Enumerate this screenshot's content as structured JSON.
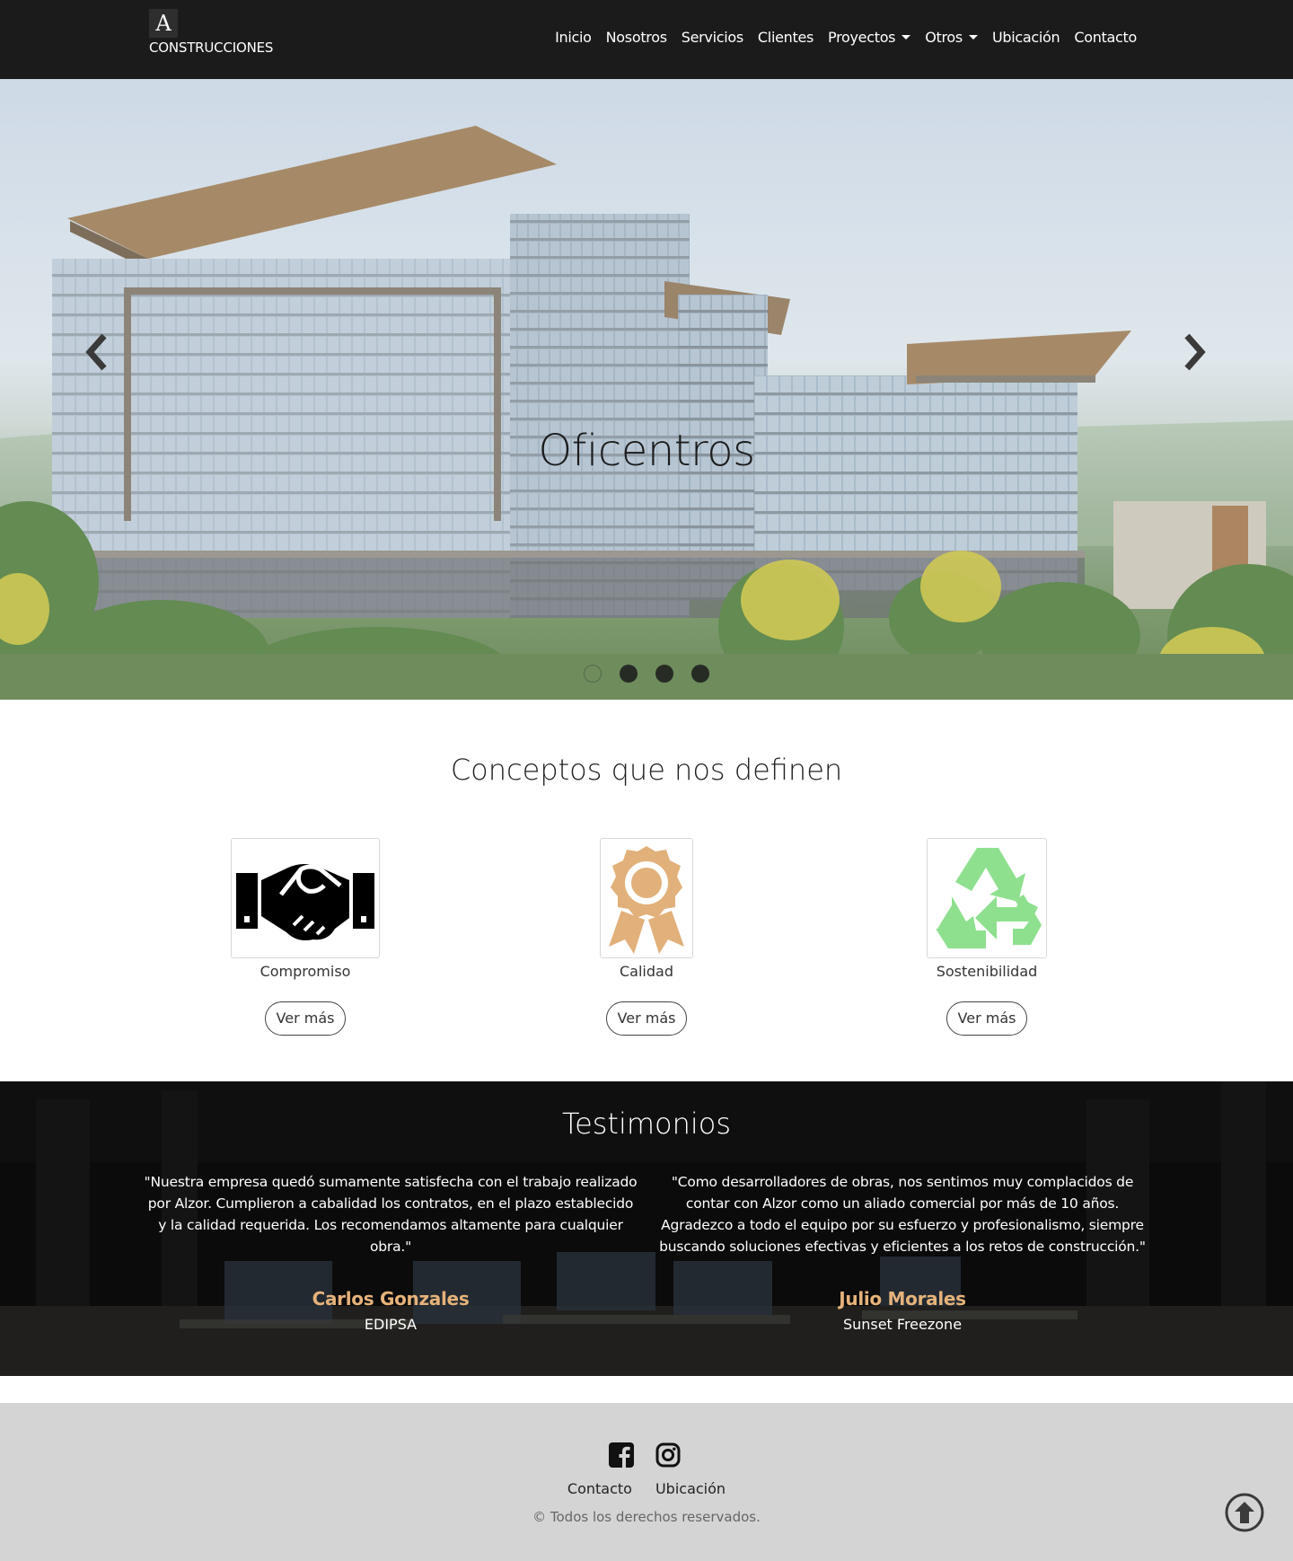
{
  "brand": {
    "mark": "A",
    "name": "CONSTRUCCIONES"
  },
  "nav": {
    "items": [
      {
        "label": "Inicio"
      },
      {
        "label": "Nosotros"
      },
      {
        "label": "Servicios"
      },
      {
        "label": "Clientes"
      },
      {
        "label": "Proyectos"
      },
      {
        "label": "Otros"
      },
      {
        "label": "Ubicación"
      },
      {
        "label": "Contacto"
      }
    ]
  },
  "hero": {
    "caption": "Oficentros",
    "slide_count": 4,
    "active_slide": 1,
    "prev_icon": "chevron-left-icon",
    "next_icon": "chevron-right-icon"
  },
  "concepts": {
    "title": "Conceptos que nos definen",
    "items": [
      {
        "label": "Compromiso",
        "icon": "handshake-icon",
        "button": "Ver más",
        "color": "#000000"
      },
      {
        "label": "Calidad",
        "icon": "award-ribbon-icon",
        "button": "Ver más",
        "color": "#e2b07a"
      },
      {
        "label": "Sostenibilidad",
        "icon": "recycle-icon",
        "button": "Ver más",
        "color": "#8ee08e"
      }
    ]
  },
  "testimonials": {
    "title": "Testimonios",
    "items": [
      {
        "quote": "\"Nuestra empresa quedó sumamente satisfecha con el trabajo realizado por Alzor. Cumplieron a cabalidad los contratos, en el plazo establecido y la calidad requerida. Los recomendamos altamente para cualquier obra.\"",
        "author": "Carlos Gonzales",
        "company": "EDIPSA"
      },
      {
        "quote": "\"Como desarrolladores de obras, nos sentimos muy complacidos de contar con Alzor como un aliado comercial por más de 10 años. Agradezco a todo el equipo por su esfuerzo y profesionalismo, siempre buscando soluciones efectivas y eficientes a los retos de construcción.\"",
        "author": "Julio Morales",
        "company": "Sunset Freezone"
      }
    ],
    "author_color": "#e6b27a"
  },
  "footer": {
    "social": [
      {
        "icon": "facebook-icon"
      },
      {
        "icon": "instagram-icon"
      }
    ],
    "links": [
      {
        "label": "Contacto"
      },
      {
        "label": "Ubicación"
      }
    ],
    "copyright": "© Todos los derechos reservados.",
    "back_to_top_icon": "arrow-up-circle-icon"
  }
}
